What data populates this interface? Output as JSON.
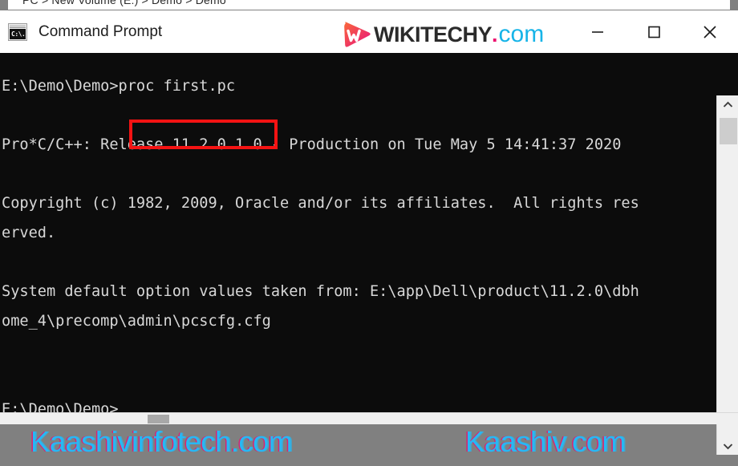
{
  "breadcrumb": {
    "text": "PC  >  New Volume (E:)  >  Demo  >  Demo"
  },
  "titlebar": {
    "icon_name": "cmd-icon",
    "icon_text": "C:\\.",
    "title": "Command Prompt",
    "controls": {
      "minimize": "Minimize",
      "maximize": "Maximize",
      "close": "Close"
    }
  },
  "logo": {
    "mark_letter": "W",
    "word": "WIKITECHY",
    "dot": ".",
    "tld": "com",
    "colors": {
      "mark_start": "#f95d3c",
      "mark_end": "#e8117f",
      "word": "#2b2b2b",
      "dot": "#ec0f6e",
      "tld": "#16b4e8"
    }
  },
  "terminal": {
    "background": "#0c0c0c",
    "foreground": "#d8d8d8",
    "lines": [
      "E:\\Demo\\Demo>proc first.pc",
      "",
      "Pro*C/C++: Release 11.2.0.1.0 - Production on Tue May 5 14:41:37 2020",
      "",
      "Copyright (c) 1982, 2009, Oracle and/or its affiliates.  All rights res",
      "erved.",
      "",
      "System default option values taken from: E:\\app\\Dell\\product\\11.2.0\\dbh",
      "ome_4\\precomp\\admin\\pcscfg.cfg",
      "",
      "",
      "E:\\Demo\\Demo>"
    ],
    "highlight": {
      "label": "proc first.pc",
      "color": "#f41313"
    }
  },
  "scrollbars": {
    "vertical": {
      "up_arrow": "▲",
      "down_arrow": "▼"
    },
    "horizontal": {
      "present": true
    }
  },
  "watermarks": {
    "left": "Kaashivinfotech.com",
    "right": "Kaashiv.com",
    "color": "#27b8f4"
  }
}
